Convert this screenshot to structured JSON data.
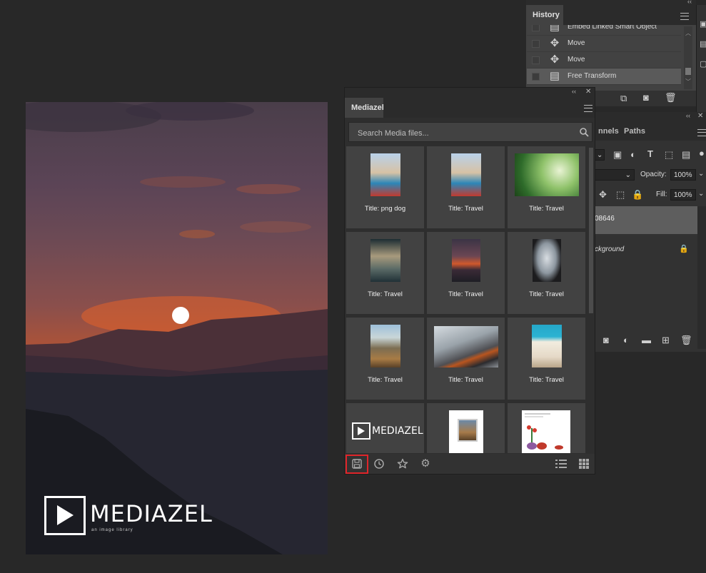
{
  "history": {
    "tab": "History",
    "rows": [
      {
        "label": "Embed Linked Smart Object",
        "icon": "document-icon"
      },
      {
        "label": "Move",
        "icon": "move-icon"
      },
      {
        "label": "Move",
        "icon": "move-icon"
      },
      {
        "label": "Free Transform",
        "icon": "document-icon",
        "selected": true
      }
    ]
  },
  "layers": {
    "tab_channels": "nnels",
    "tab_paths": "Paths",
    "opacity_label": "Opacity:",
    "opacity_value": "100%",
    "fill_label": "Fill:",
    "fill_value": "100%",
    "layer1_name": "08646",
    "layer2_name": "ckground"
  },
  "mediazel": {
    "tab": "Mediazel",
    "search_placeholder": "Search Media files...",
    "items": [
      {
        "caption": "Title: png dog"
      },
      {
        "caption": "Title: Travel"
      },
      {
        "caption": "Title: Travel"
      },
      {
        "caption": "Title: Travel"
      },
      {
        "caption": "Title: Travel"
      },
      {
        "caption": "Title: Travel"
      },
      {
        "caption": "Title: Travel"
      },
      {
        "caption": "Title: Travel"
      },
      {
        "caption": "Title: Travel"
      },
      {
        "caption": ""
      },
      {
        "caption": ""
      },
      {
        "caption": ""
      }
    ],
    "logo_text": "MEDIAZEL",
    "accent": "#e0252a"
  },
  "canvas": {
    "watermark_text": "MEDIAZEL",
    "watermark_sub": "an image library"
  }
}
